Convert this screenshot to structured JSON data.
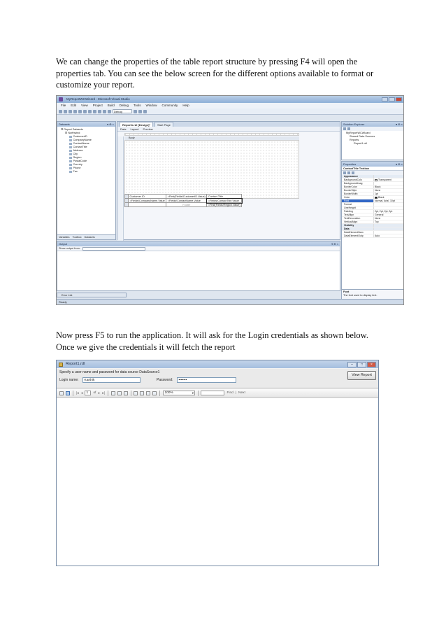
{
  "paragraph1": {
    "line1": "We can change the properties of the table report structure by pressing F4 will open the",
    "line2": "properties tab. You can see the below screen for the different options available to format or",
    "line3": "customize your report."
  },
  "paragraph2": {
    "line1": "Now press F5 to run the application. It will ask for the Login credentials as shown below.",
    "line2": "Once we give the credentials it will fetch the report"
  },
  "ide": {
    "title": "MyReportWCWizard - Microsoft Visual Studio",
    "menu": [
      "File",
      "Edit",
      "View",
      "Project",
      "Build",
      "Debug",
      "Tools",
      "Window",
      "Community",
      "Help"
    ],
    "config": "Debug",
    "datasets_panel": {
      "title": "Datasets",
      "root": "Report Datasets",
      "dataset": "Northwind",
      "fields": [
        "CustomerID",
        "CompanyName",
        "ContactName",
        "ContactTitle",
        "Address",
        "City",
        "Region",
        "PostalCode",
        "Country",
        "Phone",
        "Fax"
      ],
      "tabs": [
        "Variables",
        "Toolbox",
        "Datasets"
      ]
    },
    "designer": {
      "doc_tabs": [
        "Report1.rdl [Design]*",
        "Start Page"
      ],
      "sub_tabs": [
        "Data",
        "Layout",
        "Preview"
      ],
      "band": "Body",
      "table": {
        "row1": [
          "Customer ID",
          "=First(Fields!CustomerID.Value)",
          "Contact Title"
        ],
        "row2": [
          "=Fields!CompanyName.Value",
          "=Fields!ContactName.Value",
          "=Fields!ContactTitle.Value"
        ],
        "row3": [
          "",
          "Footer",
          "=First(Fields!Region.Value)"
        ]
      }
    },
    "solution_explorer": {
      "title": "Solution Explorer",
      "items": [
        "MyReportWCWizard",
        "Shared Data Sources",
        "Reports",
        "Report1.rdl"
      ]
    },
    "properties": {
      "title": "Properties",
      "object": "ContactTitle  Textbox",
      "rows": [
        {
          "k": "Appearance",
          "v": "",
          "cat": true
        },
        {
          "k": "BackgroundColo",
          "v": "Transparent"
        },
        {
          "k": "BackgroundImag",
          "v": ""
        },
        {
          "k": "BorderColor",
          "v": "Black"
        },
        {
          "k": "BorderStyle",
          "v": "None"
        },
        {
          "k": "BorderWidth",
          "v": "1pt"
        },
        {
          "k": "Color",
          "v": "Black"
        },
        {
          "k": "Font",
          "v": "Normal, Arial, 10pt",
          "hl": true
        },
        {
          "k": "Format",
          "v": ""
        },
        {
          "k": "LineHeight",
          "v": ""
        },
        {
          "k": "Padding",
          "v": "2pt, 2pt, 2pt, 2pt"
        },
        {
          "k": "TextAlign",
          "v": "General"
        },
        {
          "k": "TextDecoration",
          "v": "None"
        },
        {
          "k": "VerticalAlign",
          "v": "Top"
        },
        {
          "k": "Visibility",
          "v": "",
          "cat": true
        },
        {
          "k": "Data",
          "v": "",
          "cat": true
        },
        {
          "k": "DataElementNam",
          "v": ""
        },
        {
          "k": "DataElementOutp",
          "v": "Auto"
        }
      ],
      "desc_title": "Font",
      "desc_text": "The font used to display text."
    },
    "output": {
      "title": "Output",
      "show_from": "Show output from:"
    },
    "error_list": "Error List",
    "status": "Ready"
  },
  "viewer": {
    "title": "Report1.rdl",
    "prompt": "Specify a user name and password for data source DataSource1",
    "login_label": "Login name:",
    "login_value": "Karthik",
    "password_label": "Password:",
    "password_value": "•••••••",
    "view_button": "View Report",
    "page": "1",
    "of": "of",
    "zoom": "100%",
    "find": "Find",
    "next": "Next",
    "separator": "|"
  }
}
